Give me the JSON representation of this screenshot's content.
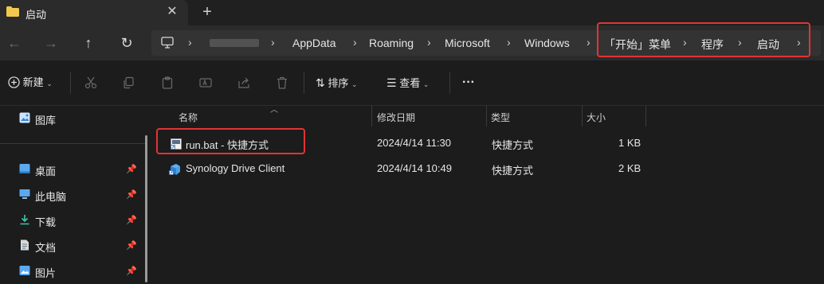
{
  "tab": {
    "title": "启动",
    "close_glyph": "✕",
    "new_tab_glyph": "+"
  },
  "nav": {
    "back_glyph": "←",
    "forward_glyph": "→",
    "up_glyph": "↑",
    "refresh_glyph": "↻",
    "breadcrumbs": [
      "AppData",
      "Roaming",
      "Microsoft",
      "Windows",
      "「开始」菜单",
      "程序",
      "启动"
    ]
  },
  "toolbar": {
    "new_label": "新建",
    "sort_label": "排序",
    "view_label": "查看",
    "more_glyph": "···"
  },
  "sidebar": {
    "top_item": {
      "label": "图库",
      "icon": "gallery-icon"
    },
    "items": [
      {
        "label": "桌面",
        "icon": "desktop-icon"
      },
      {
        "label": "此电脑",
        "icon": "computer-icon"
      },
      {
        "label": "下载",
        "icon": "download-icon"
      },
      {
        "label": "文档",
        "icon": "document-icon"
      },
      {
        "label": "图片",
        "icon": "pictures-icon"
      }
    ]
  },
  "table": {
    "columns": [
      "名称",
      "修改日期",
      "类型",
      "大小"
    ],
    "rows": [
      {
        "name": "run.bat - 快捷方式",
        "modified": "2024/4/14 11:30",
        "type": "快捷方式",
        "size": "1 KB"
      },
      {
        "name": "Synology Drive Client",
        "modified": "2024/4/14 10:49",
        "type": "快捷方式",
        "size": "2 KB"
      }
    ]
  },
  "colors": {
    "highlight": "#e23434",
    "folder": "#f2c94c",
    "accent": "#4aa3ff"
  }
}
